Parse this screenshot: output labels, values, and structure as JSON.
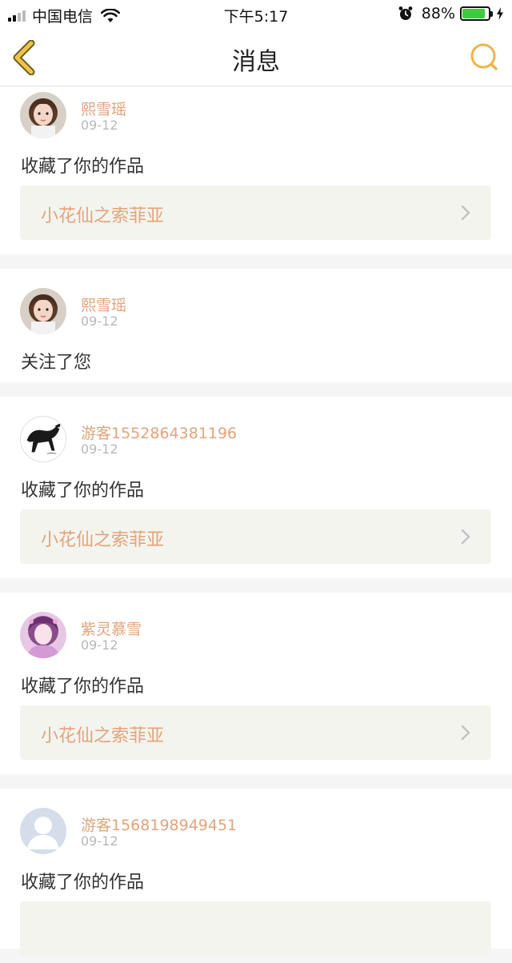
{
  "status_bar": {
    "carrier": "中国电信",
    "time": "下午5:17",
    "battery_percent": "88%",
    "battery_level": 0.88
  },
  "nav": {
    "title": "消息",
    "accent_color": "#f0b24a"
  },
  "messages": [
    {
      "name": "熙雪瑶",
      "date": "09-12",
      "action": "收藏了你的作品",
      "work_title": "小花仙之索菲亚",
      "avatar": "girl-photo"
    },
    {
      "name": "熙雪瑶",
      "date": "09-12",
      "action": "关注了您",
      "work_title": "",
      "avatar": "girl-photo"
    },
    {
      "name": "游客1552864381196",
      "date": "09-12",
      "action": "收藏了你的作品",
      "work_title": "小花仙之索菲亚",
      "avatar": "horse-ink-painting"
    },
    {
      "name": "紫灵慕雪",
      "date": "09-12",
      "action": "收藏了你的作品",
      "work_title": "小花仙之索菲亚",
      "avatar": "anime-girl"
    },
    {
      "name": "游客1568198949451",
      "date": "09-12",
      "action": "收藏了你的作品",
      "work_title": "",
      "avatar": "default-user"
    }
  ]
}
